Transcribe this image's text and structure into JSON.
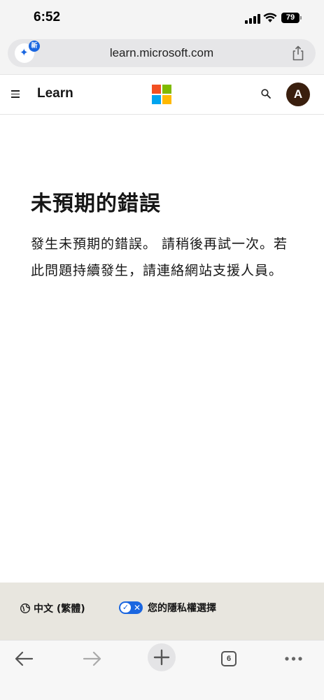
{
  "status_bar": {
    "time": "6:52",
    "battery": "79"
  },
  "address_bar": {
    "url": "learn.microsoft.com",
    "ai_badge_label": "新"
  },
  "header": {
    "site_title": "Learn",
    "avatar_initial": "A"
  },
  "error": {
    "title": "未預期的錯誤",
    "message": "發生未預期的錯誤。 請稍後再試一次。若此問題持續發生，請連絡網站支援人員。"
  },
  "footer": {
    "language_label": "中文 (繁體)",
    "privacy_label": "您的隱私權選擇"
  },
  "toolbar": {
    "tab_count": "6"
  },
  "colors": {
    "accent_blue": "#1a66e0",
    "avatar_bg": "#3a1f0e",
    "footer_bg": "#e8e6df",
    "ms_red": "#f25022",
    "ms_green": "#7fba00",
    "ms_blue": "#00a4ef",
    "ms_yellow": "#ffb900"
  }
}
